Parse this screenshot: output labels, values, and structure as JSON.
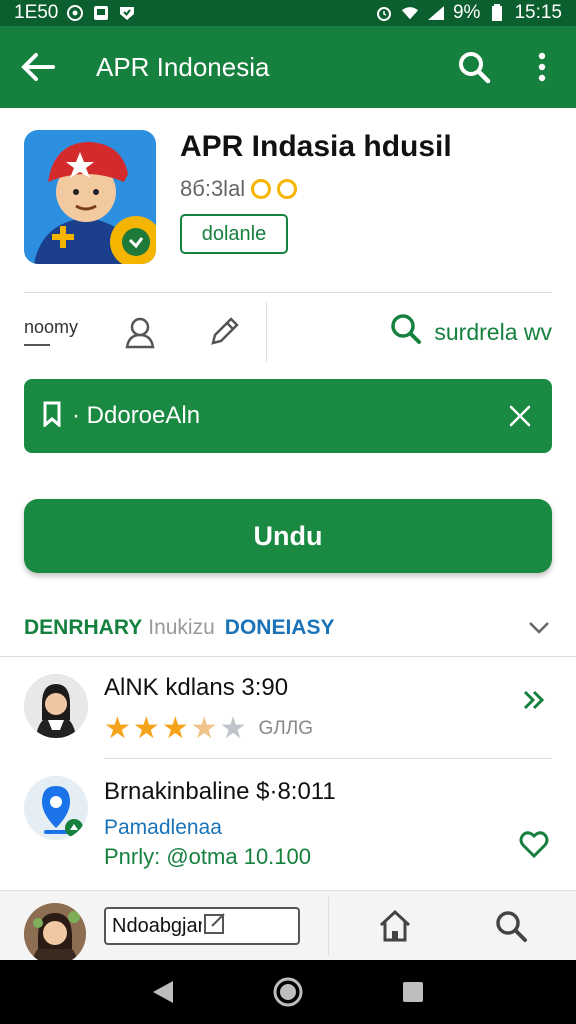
{
  "status_bar": {
    "time_left": "1E50",
    "battery": "9%",
    "time_right": "15:15",
    "icons": [
      "whatsapp-icon",
      "image-icon",
      "shield-icon",
      "alarm-icon",
      "wifi-icon",
      "signal-icon",
      "battery-icon"
    ]
  },
  "app_bar": {
    "title": "APR Indonesia",
    "icons": [
      "back-arrow-icon",
      "search-icon",
      "more-vert-icon"
    ],
    "background": "#16803e"
  },
  "app_header": {
    "name": "APR Indasia hdusil",
    "rating_text": "8б:3lal",
    "install_chip": "dolanle"
  },
  "action_row": {
    "left_text": "noomy",
    "search_label": "surdrela wv",
    "icons": [
      "person-outline-icon",
      "pencil-icon",
      "search-icon"
    ]
  },
  "banner": {
    "label": "· DdoroeAln",
    "icons": [
      "bookmark-icon",
      "close-icon"
    ],
    "background": "#1a8a43"
  },
  "primary_button": {
    "label": "Undu"
  },
  "section_tabs": {
    "tab1": "DENRHARY",
    "tab2": "Inukizu",
    "tab3": "DONEIASY"
  },
  "reviews": [
    {
      "title": "AlNK kdlans 3:90",
      "rating": 3.5,
      "rating_max": 5,
      "tail": "GЛЛG",
      "action_icon": "double-chevron-right-icon"
    },
    {
      "title": "Brnakinbaline $·8:011",
      "line2": "Pamadlenaa",
      "line3": "Pnrly: @otma 10.100",
      "action_icon": "heart-outline-icon"
    }
  ],
  "bottom_bar": {
    "search_text": "Ndoabgjanim",
    "icons": [
      "edit-square-icon",
      "home-icon",
      "search-icon"
    ]
  },
  "nav_bar": {
    "icons": [
      "nav-back-icon",
      "nav-home-icon",
      "nav-recents-icon"
    ]
  },
  "colors": {
    "primary_green": "#16803e",
    "status_green": "#0b5e2d",
    "link_blue": "#1a73b8",
    "star_gold": "#f4a31a"
  }
}
